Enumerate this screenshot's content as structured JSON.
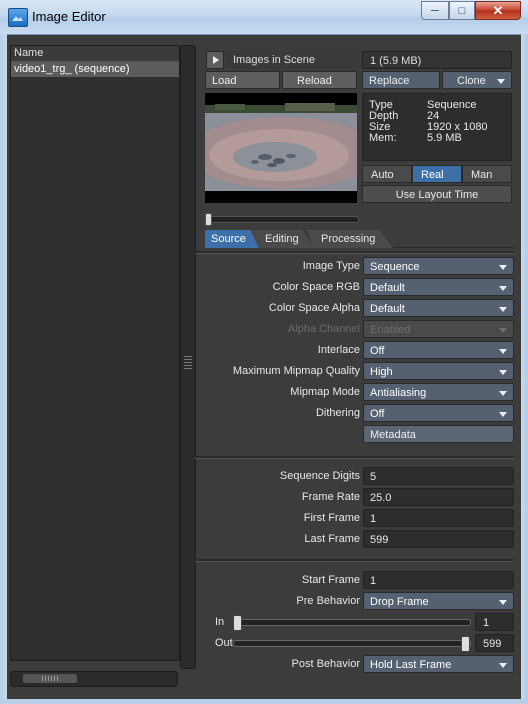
{
  "window": {
    "title": "Image Editor"
  },
  "list": {
    "header": "Name",
    "items": [
      {
        "label": "video1_trg_ (sequence)"
      }
    ]
  },
  "toolbar": {
    "images_in_scene_label": "Images in Scene",
    "images_in_scene_value": "1 (5.9 MB)",
    "load": "Load",
    "reload": "Reload",
    "replace": "Replace",
    "clone": "Clone"
  },
  "info": {
    "type_label": "Type",
    "type_value": "Sequence",
    "depth_label": "Depth",
    "depth_value": "24",
    "size_label": "Size",
    "size_value": "1920 x 1080",
    "mem_label": "Mem:",
    "mem_value": "5.9 MB"
  },
  "time_modes": {
    "auto": "Auto",
    "real": "Real",
    "man": "Man",
    "selected": "Real"
  },
  "use_layout_time": "Use Layout Time",
  "tabs": [
    {
      "label": "Source",
      "active": true
    },
    {
      "label": "Editing",
      "active": false
    },
    {
      "label": "Processing",
      "active": false
    }
  ],
  "source": {
    "image_type": {
      "label": "Image Type",
      "value": "Sequence"
    },
    "color_space_rgb": {
      "label": "Color Space RGB",
      "value": "Default"
    },
    "color_space_alpha": {
      "label": "Color Space Alpha",
      "value": "Default"
    },
    "alpha_channel": {
      "label": "Alpha Channel",
      "value": "Enabled",
      "disabled": true
    },
    "interlace": {
      "label": "Interlace",
      "value": "Off"
    },
    "max_mipmap_quality": {
      "label": "Maximum Mipmap Quality",
      "value": "High"
    },
    "mipmap_mode": {
      "label": "Mipmap Mode",
      "value": "Antialiasing"
    },
    "dithering": {
      "label": "Dithering",
      "value": "Off"
    },
    "metadata": "Metadata"
  },
  "sequence": {
    "digits": {
      "label": "Sequence Digits",
      "value": "5"
    },
    "frame_rate": {
      "label": "Frame Rate",
      "value": "25.0"
    },
    "first_frame": {
      "label": "First Frame",
      "value": "1"
    },
    "last_frame": {
      "label": "Last Frame",
      "value": "599"
    }
  },
  "timing": {
    "start_frame": {
      "label": "Start Frame",
      "value": "1"
    },
    "pre_behavior": {
      "label": "Pre Behavior",
      "value": "Drop Frame"
    },
    "in": {
      "label": "In",
      "value": "1",
      "position": 0.0
    },
    "out": {
      "label": "Out",
      "value": "599",
      "position": 1.0
    },
    "post_behavior": {
      "label": "Post Behavior",
      "value": "Hold Last Frame"
    }
  },
  "colors": {
    "accent_blue": "#3d6fa8",
    "dropdown_bg": "#556070",
    "panel_bg": "#3c3c3c"
  }
}
